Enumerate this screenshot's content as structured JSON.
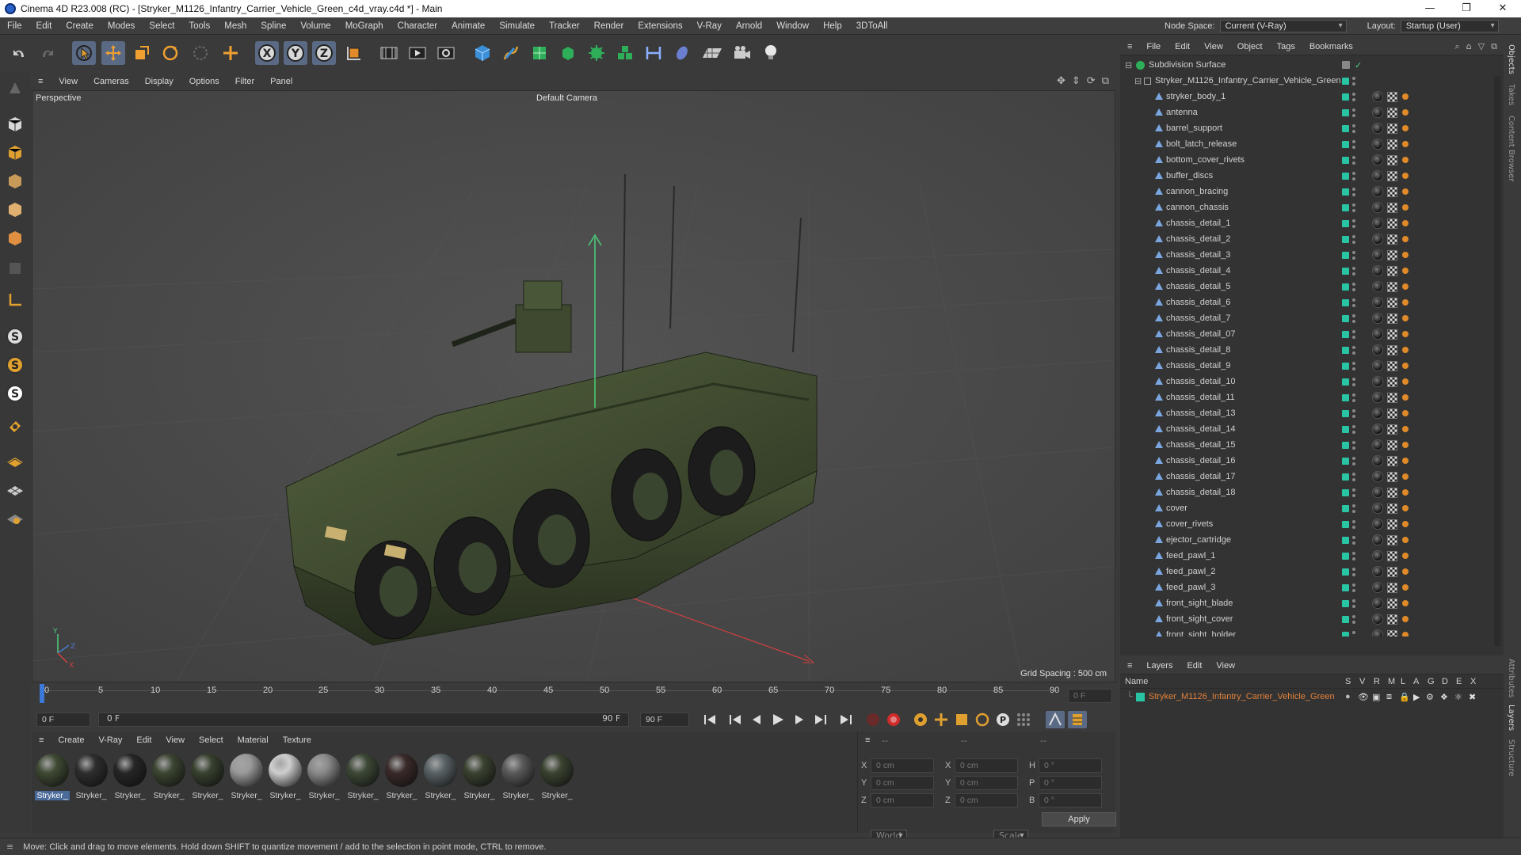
{
  "window": {
    "title": "Cinema 4D R23.008 (RC) - [Stryker_M1126_Infantry_Carrier_Vehicle_Green_c4d_vray.c4d *] - Main",
    "controls": [
      "—",
      "❐",
      "✕"
    ]
  },
  "menubar": {
    "items": [
      "File",
      "Edit",
      "Create",
      "Modes",
      "Select",
      "Tools",
      "Mesh",
      "Spline",
      "Volume",
      "MoGraph",
      "Character",
      "Animate",
      "Simulate",
      "Tracker",
      "Render",
      "Extensions",
      "V-Ray",
      "Arnold",
      "Window",
      "Help",
      "3DToAll"
    ],
    "node_space_label": "Node Space:",
    "node_space_value": "Current (V-Ray)",
    "layout_label": "Layout:",
    "layout_value": "Startup (User)"
  },
  "toolbar": {
    "icons": [
      "undo-icon",
      "redo-icon",
      "select-icon",
      "move-icon",
      "scale-icon",
      "rotate-icon",
      "live-select-icon",
      "transform-icon",
      "x-axis-icon",
      "y-axis-icon",
      "z-axis-icon",
      "coordinate-system-icon",
      "render-view-icon",
      "render-picture-viewer-icon",
      "render-settings-icon",
      "cube-icon",
      "pen-icon",
      "subdivision-icon",
      "extrude-icon",
      "mograph-cloner-icon",
      "deformer-icon",
      "scene-icon",
      "field-icon",
      "floor-icon",
      "camera-icon",
      "light-icon"
    ],
    "axis_labels": [
      "X",
      "Y",
      "Z"
    ]
  },
  "viewport": {
    "menu": [
      "View",
      "Cameras",
      "Display",
      "Options",
      "Filter",
      "Panel"
    ],
    "projection_label": "Perspective",
    "camera_label": "Default Camera",
    "grid_spacing": "Grid Spacing : 500 cm",
    "axis_labels": {
      "y": "Y",
      "z": "Z",
      "x": "X"
    }
  },
  "timeline": {
    "ticks": [
      "0",
      "5",
      "10",
      "15",
      "20",
      "25",
      "30",
      "35",
      "40",
      "45",
      "50",
      "55",
      "60",
      "65",
      "70",
      "75",
      "80",
      "85",
      "90"
    ],
    "current_frame": "0 F"
  },
  "transport": {
    "start_field": "0 F",
    "range_start": "0 F",
    "range_end": "90 F",
    "end_field": "90 F"
  },
  "material_manager": {
    "menu": [
      "Create",
      "V-Ray",
      "Edit",
      "View",
      "Select",
      "Material",
      "Texture"
    ],
    "materials": [
      {
        "label": "Stryker_",
        "color": "#3f4a34",
        "selected": true
      },
      {
        "label": "Stryker_",
        "color": "#2e2e2e"
      },
      {
        "label": "Stryker_",
        "color": "#262626"
      },
      {
        "label": "Stryker_",
        "color": "#3c4532"
      },
      {
        "label": "Stryker_",
        "color": "#38412f"
      },
      {
        "label": "Stryker_",
        "color": "#9a9a9a"
      },
      {
        "label": "Stryker_",
        "color": "#cfcfcf"
      },
      {
        "label": "Stryker_",
        "color": "#8a8a8a"
      },
      {
        "label": "Stryker_",
        "color": "#3d4836"
      },
      {
        "label": "Stryker_",
        "color": "#3a2a2a"
      },
      {
        "label": "Stryker_",
        "color": "#5a6266"
      },
      {
        "label": "Stryker_",
        "color": "#3a4230"
      },
      {
        "label": "Stryker_",
        "color": "#5a5a5a"
      },
      {
        "label": "Stryker_",
        "color": "#3b4331"
      }
    ]
  },
  "coordinates": {
    "header": [
      "--",
      "--",
      "--"
    ],
    "rows": [
      {
        "a": "X",
        "av": "0 cm",
        "b": "X",
        "bv": "0 cm",
        "c": "H",
        "cv": "0 °"
      },
      {
        "a": "Y",
        "av": "0 cm",
        "b": "Y",
        "bv": "0 cm",
        "c": "P",
        "cv": "0 °"
      },
      {
        "a": "Z",
        "av": "0 cm",
        "b": "Z",
        "bv": "0 cm",
        "c": "B",
        "cv": "0 °"
      }
    ],
    "mode_left": "World",
    "mode_right": "Scale",
    "apply_label": "Apply"
  },
  "object_manager": {
    "menu": [
      "File",
      "Edit",
      "View",
      "Object",
      "Tags",
      "Bookmarks"
    ],
    "root": "Subdivision Surface",
    "group": "Stryker_M1126_Infantry_Carrier_Vehicle_Green",
    "objects": [
      "stryker_body_1",
      "antenna",
      "barrel_support",
      "bolt_latch_release",
      "bottom_cover_rivets",
      "buffer_discs",
      "cannon_bracing",
      "cannon_chassis",
      "chassis_detail_1",
      "chassis_detail_2",
      "chassis_detail_3",
      "chassis_detail_4",
      "chassis_detail_5",
      "chassis_detail_6",
      "chassis_detail_7",
      "chassis_detail_07",
      "chassis_detail_8",
      "chassis_detail_9",
      "chassis_detail_10",
      "chassis_detail_11",
      "chassis_detail_13",
      "chassis_detail_14",
      "chassis_detail_15",
      "chassis_detail_16",
      "chassis_detail_17",
      "chassis_detail_18",
      "cover",
      "cover_rivets",
      "ejector_cartridge",
      "feed_pawl_1",
      "feed_pawl_2",
      "feed_pawl_3",
      "front_sight_blade",
      "front_sight_cover",
      "front_sight_holder"
    ]
  },
  "layer_manager": {
    "menu": [
      "Layers",
      "Edit",
      "View"
    ],
    "columns_name": "Name",
    "columns": [
      "S",
      "V",
      "R",
      "M",
      "L",
      "A",
      "G",
      "D",
      "E",
      "X"
    ],
    "layer_name": "Stryker_M1126_Infantry_Carrier_Vehicle_Green",
    "layer_color": "#e0813a"
  },
  "side_tabs": [
    "Objects",
    "Takes",
    "Content Browser",
    "Attributes",
    "Layers",
    "Structure"
  ],
  "status_text": "Move: Click and drag to move elements. Hold down SHIFT to quantize movement / add to the selection in point mode, CTRL to remove."
}
